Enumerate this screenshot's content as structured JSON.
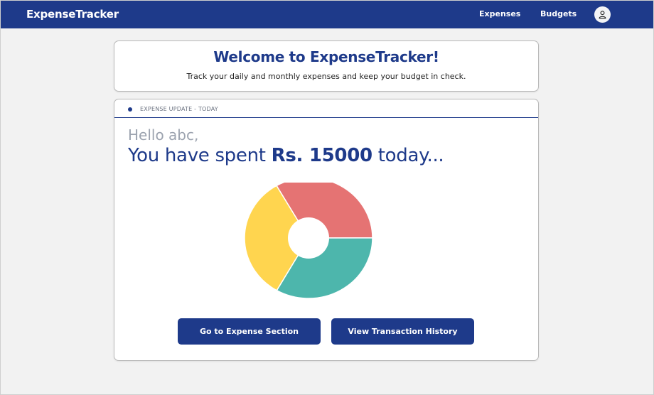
{
  "navbar": {
    "brand": "ExpenseTracker",
    "links": [
      "Expenses",
      "Budgets"
    ],
    "avatar_icon": "user-icon"
  },
  "welcome": {
    "title": "Welcome to ExpenseTracker!",
    "subtitle": "Track your daily and monthly expenses and keep your budget in check."
  },
  "update": {
    "header": "EXPENSE UPDATE - TODAY",
    "greeting": "Hello abc,",
    "spent_prefix": "You have spent ",
    "spent_amount": "Rs. 15000",
    "spent_suffix": " today..."
  },
  "chart_data": {
    "type": "pie",
    "title": "",
    "slices": [
      {
        "value": 33.3,
        "color": "#e57373"
      },
      {
        "value": 33.3,
        "color": "#4db6ac"
      },
      {
        "value": 33.4,
        "color": "#ffd54f"
      }
    ],
    "donut": true
  },
  "buttons": {
    "expense": "Go to Expense Section",
    "history": "View Transaction History"
  },
  "colors": {
    "primary": "#1e3a8a",
    "background": "#f2f2f2"
  }
}
